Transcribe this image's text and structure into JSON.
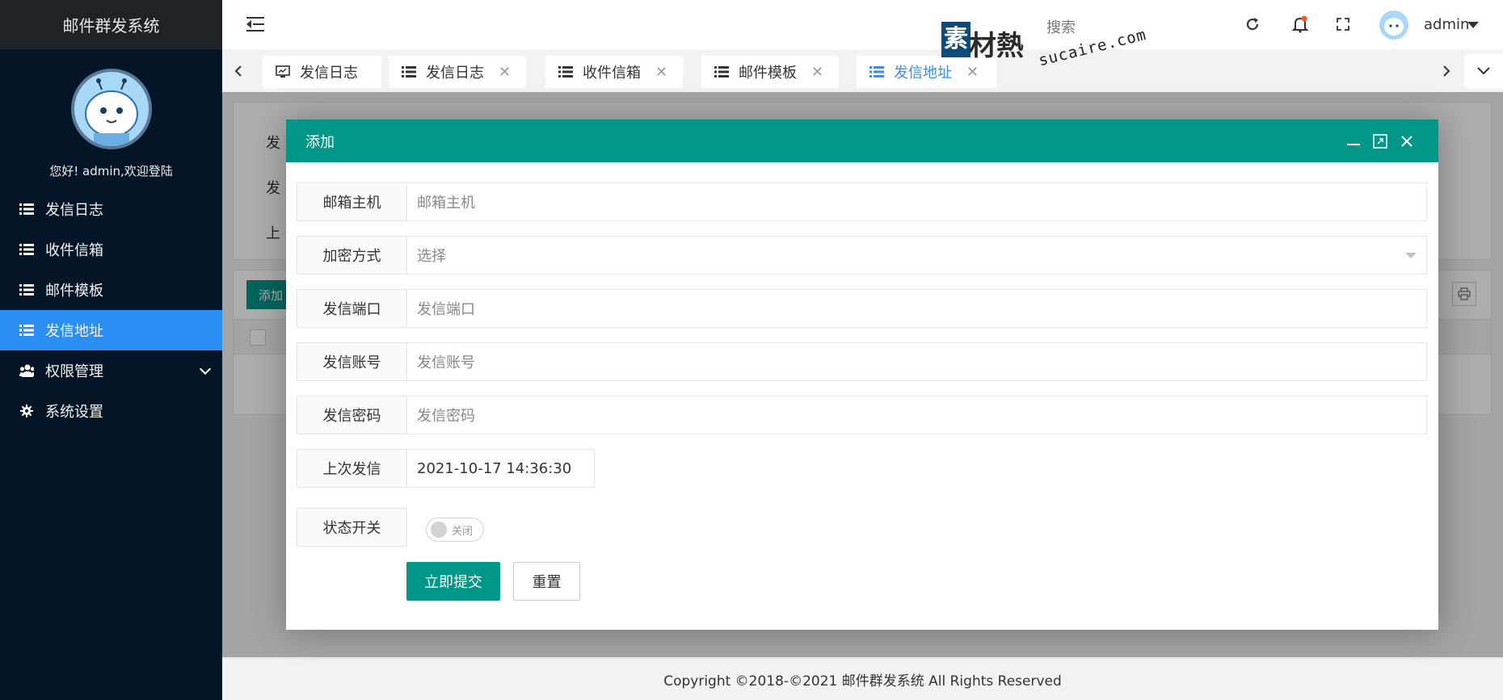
{
  "app": {
    "title": "邮件群发系统",
    "welcome": "您好! admin,欢迎登陆"
  },
  "sidebar": {
    "items": [
      {
        "label": "发信日志",
        "icon": "list-icon"
      },
      {
        "label": "收件信箱",
        "icon": "list-icon"
      },
      {
        "label": "邮件模板",
        "icon": "list-icon"
      },
      {
        "label": "发信地址",
        "icon": "list-icon",
        "active": true
      },
      {
        "label": "权限管理",
        "icon": "users-icon"
      },
      {
        "label": "系统设置",
        "icon": "gear-icon"
      }
    ]
  },
  "header": {
    "search": "搜索",
    "user": "admin",
    "watermark": {
      "brand_first": "素",
      "brand_rest": "材熱",
      "url": "sucaire.com"
    }
  },
  "tabs": [
    {
      "label": "发信日志",
      "icon": "monitor-icon",
      "closable": false
    },
    {
      "label": "发信日志",
      "icon": "list-icon",
      "closable": true
    },
    {
      "label": "收件信箱",
      "icon": "list-icon",
      "closable": true
    },
    {
      "label": "邮件模板",
      "icon": "list-icon",
      "closable": true
    },
    {
      "label": "发信地址",
      "icon": "list-icon",
      "closable": true,
      "active": true
    }
  ],
  "background": {
    "filter_labels": [
      "发",
      "发",
      "上"
    ],
    "add_button": "添加"
  },
  "modal": {
    "title": "添加",
    "fields": {
      "host": {
        "label": "邮箱主机",
        "placeholder": "邮箱主机"
      },
      "encryption": {
        "label": "加密方式",
        "placeholder": "选择"
      },
      "port": {
        "label": "发信端口",
        "placeholder": "发信端口"
      },
      "account": {
        "label": "发信账号",
        "placeholder": "发信账号"
      },
      "password": {
        "label": "发信密码",
        "placeholder": "发信密码"
      },
      "last_sent": {
        "label": "上次发信",
        "value": "2021-10-17 14:36:30"
      },
      "status": {
        "label": "状态开关",
        "switch_text": "关闭",
        "on": false
      }
    },
    "submit": "立即提交",
    "reset": "重置"
  },
  "footer": {
    "text": "Copyright ©2018-©2021 邮件群发系统 All Rights Reserved"
  },
  "colors": {
    "sidebar_bg": "#041527",
    "active": "#2b8ef2",
    "primary": "#009688",
    "tab_active": "#3a8ee6"
  }
}
